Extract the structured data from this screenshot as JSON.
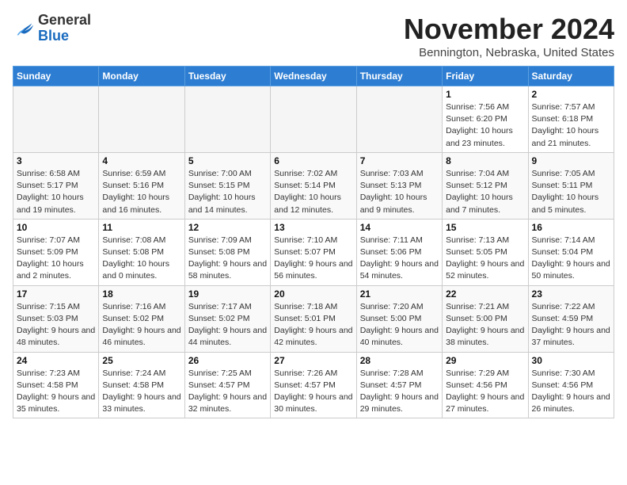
{
  "logo": {
    "general": "General",
    "blue": "Blue"
  },
  "title": "November 2024",
  "location": "Bennington, Nebraska, United States",
  "days_of_week": [
    "Sunday",
    "Monday",
    "Tuesday",
    "Wednesday",
    "Thursday",
    "Friday",
    "Saturday"
  ],
  "weeks": [
    [
      {
        "day": "",
        "info": ""
      },
      {
        "day": "",
        "info": ""
      },
      {
        "day": "",
        "info": ""
      },
      {
        "day": "",
        "info": ""
      },
      {
        "day": "",
        "info": ""
      },
      {
        "day": "1",
        "info": "Sunrise: 7:56 AM\nSunset: 6:20 PM\nDaylight: 10 hours and 23 minutes."
      },
      {
        "day": "2",
        "info": "Sunrise: 7:57 AM\nSunset: 6:18 PM\nDaylight: 10 hours and 21 minutes."
      }
    ],
    [
      {
        "day": "3",
        "info": "Sunrise: 6:58 AM\nSunset: 5:17 PM\nDaylight: 10 hours and 19 minutes."
      },
      {
        "day": "4",
        "info": "Sunrise: 6:59 AM\nSunset: 5:16 PM\nDaylight: 10 hours and 16 minutes."
      },
      {
        "day": "5",
        "info": "Sunrise: 7:00 AM\nSunset: 5:15 PM\nDaylight: 10 hours and 14 minutes."
      },
      {
        "day": "6",
        "info": "Sunrise: 7:02 AM\nSunset: 5:14 PM\nDaylight: 10 hours and 12 minutes."
      },
      {
        "day": "7",
        "info": "Sunrise: 7:03 AM\nSunset: 5:13 PM\nDaylight: 10 hours and 9 minutes."
      },
      {
        "day": "8",
        "info": "Sunrise: 7:04 AM\nSunset: 5:12 PM\nDaylight: 10 hours and 7 minutes."
      },
      {
        "day": "9",
        "info": "Sunrise: 7:05 AM\nSunset: 5:11 PM\nDaylight: 10 hours and 5 minutes."
      }
    ],
    [
      {
        "day": "10",
        "info": "Sunrise: 7:07 AM\nSunset: 5:09 PM\nDaylight: 10 hours and 2 minutes."
      },
      {
        "day": "11",
        "info": "Sunrise: 7:08 AM\nSunset: 5:08 PM\nDaylight: 10 hours and 0 minutes."
      },
      {
        "day": "12",
        "info": "Sunrise: 7:09 AM\nSunset: 5:08 PM\nDaylight: 9 hours and 58 minutes."
      },
      {
        "day": "13",
        "info": "Sunrise: 7:10 AM\nSunset: 5:07 PM\nDaylight: 9 hours and 56 minutes."
      },
      {
        "day": "14",
        "info": "Sunrise: 7:11 AM\nSunset: 5:06 PM\nDaylight: 9 hours and 54 minutes."
      },
      {
        "day": "15",
        "info": "Sunrise: 7:13 AM\nSunset: 5:05 PM\nDaylight: 9 hours and 52 minutes."
      },
      {
        "day": "16",
        "info": "Sunrise: 7:14 AM\nSunset: 5:04 PM\nDaylight: 9 hours and 50 minutes."
      }
    ],
    [
      {
        "day": "17",
        "info": "Sunrise: 7:15 AM\nSunset: 5:03 PM\nDaylight: 9 hours and 48 minutes."
      },
      {
        "day": "18",
        "info": "Sunrise: 7:16 AM\nSunset: 5:02 PM\nDaylight: 9 hours and 46 minutes."
      },
      {
        "day": "19",
        "info": "Sunrise: 7:17 AM\nSunset: 5:02 PM\nDaylight: 9 hours and 44 minutes."
      },
      {
        "day": "20",
        "info": "Sunrise: 7:18 AM\nSunset: 5:01 PM\nDaylight: 9 hours and 42 minutes."
      },
      {
        "day": "21",
        "info": "Sunrise: 7:20 AM\nSunset: 5:00 PM\nDaylight: 9 hours and 40 minutes."
      },
      {
        "day": "22",
        "info": "Sunrise: 7:21 AM\nSunset: 5:00 PM\nDaylight: 9 hours and 38 minutes."
      },
      {
        "day": "23",
        "info": "Sunrise: 7:22 AM\nSunset: 4:59 PM\nDaylight: 9 hours and 37 minutes."
      }
    ],
    [
      {
        "day": "24",
        "info": "Sunrise: 7:23 AM\nSunset: 4:58 PM\nDaylight: 9 hours and 35 minutes."
      },
      {
        "day": "25",
        "info": "Sunrise: 7:24 AM\nSunset: 4:58 PM\nDaylight: 9 hours and 33 minutes."
      },
      {
        "day": "26",
        "info": "Sunrise: 7:25 AM\nSunset: 4:57 PM\nDaylight: 9 hours and 32 minutes."
      },
      {
        "day": "27",
        "info": "Sunrise: 7:26 AM\nSunset: 4:57 PM\nDaylight: 9 hours and 30 minutes."
      },
      {
        "day": "28",
        "info": "Sunrise: 7:28 AM\nSunset: 4:57 PM\nDaylight: 9 hours and 29 minutes."
      },
      {
        "day": "29",
        "info": "Sunrise: 7:29 AM\nSunset: 4:56 PM\nDaylight: 9 hours and 27 minutes."
      },
      {
        "day": "30",
        "info": "Sunrise: 7:30 AM\nSunset: 4:56 PM\nDaylight: 9 hours and 26 minutes."
      }
    ]
  ]
}
